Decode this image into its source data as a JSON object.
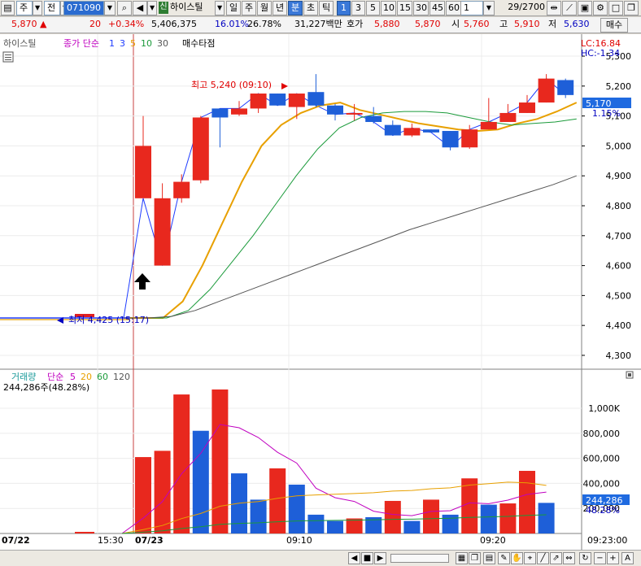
{
  "toolbar": {
    "market_code": "주",
    "prev_label": "전",
    "stock_code": "071090",
    "badge_new": "신",
    "stock_name": "하이스틸",
    "periods": [
      "일",
      "주",
      "월",
      "년",
      "분",
      "초",
      "틱"
    ],
    "selected_period": "분",
    "intervals": [
      "1",
      "3",
      "5",
      "10",
      "15",
      "30",
      "45",
      "60"
    ],
    "selected_interval": "1",
    "count_value": "1",
    "page_counter": "29/2700"
  },
  "quote": {
    "price": "5,870",
    "price_arrow": "▲",
    "change": "20",
    "change_pct": "+0.34%",
    "volume": "5,406,375",
    "vol_ratio1": "16.01%",
    "vol_ratio2": "26.78%",
    "amount": "31,227백만",
    "bid_label": "호가",
    "bid1": "5,880",
    "bid2": "5,870",
    "open_label": "시",
    "open": "5,760",
    "high_label": "고",
    "high": "5,910",
    "low_label": "저",
    "low": "5,630",
    "buy_label": "매수"
  },
  "price_panel": {
    "legend_name": "하이스틸",
    "legend_ma": "종가 단순",
    "ma_periods": [
      "1",
      "3",
      "5",
      "10",
      "30"
    ],
    "ma_colors": [
      "#1e3cff",
      "#1e3cff",
      "#e8a000",
      "#1a9a3a",
      "#555555"
    ],
    "legend_extra": "매수타점",
    "lc_label": "LC:16.84",
    "hc_label": "HC:-1.34",
    "high_annot": "최고 5,240 (09:10)",
    "low_annot": "최저 4,425 (15:17)",
    "current_price": "5,170",
    "current_pct": "1.15%"
  },
  "volume_panel": {
    "legend_name": "거래량",
    "legend_ma": "단순",
    "ma_periods": [
      "5",
      "20",
      "60",
      "120"
    ],
    "ma_colors": [
      "#c000c0",
      "#e8a000",
      "#1a9a3a",
      "#555555"
    ],
    "current_volume": "244,286주(48.28%)",
    "axis_current": "244,286",
    "axis_pct": "48.28%"
  },
  "x_axis": {
    "labels": [
      "07/22",
      "15:30",
      "07/23",
      "09:10",
      "09:20",
      "09:23:00"
    ]
  },
  "chart_data": {
    "type": "candlestick",
    "y_axis_ticks": [
      "5,300",
      "5,200",
      "5,100",
      "5,000",
      "4,900",
      "4,800",
      "4,700",
      "4,600",
      "4,500",
      "4,400",
      "4,300"
    ],
    "y_range": [
      4270,
      5330
    ],
    "volume_axis_ticks": [
      "1,000K",
      "800,000",
      "600,000",
      "400,000",
      "200,000"
    ],
    "volume_range": [
      0,
      1130000
    ],
    "candles": [
      {
        "o": 5000,
        "h": 5100,
        "l": 4995,
        "c": 4825,
        "up": true
      },
      {
        "o": 4825,
        "h": 4875,
        "l": 4710,
        "c": 4600,
        "up": true
      },
      {
        "o": 4825,
        "h": 4905,
        "l": 4810,
        "c": 4880,
        "up": true
      },
      {
        "o": 4885,
        "h": 5100,
        "l": 4875,
        "c": 5095,
        "up": true
      },
      {
        "o": 5095,
        "h": 5115,
        "l": 4995,
        "c": 5125,
        "up": false
      },
      {
        "o": 5105,
        "h": 5150,
        "l": 5100,
        "c": 5125,
        "up": true
      },
      {
        "o": 5125,
        "h": 5170,
        "l": 5110,
        "c": 5175,
        "up": true
      },
      {
        "o": 5175,
        "h": 5175,
        "l": 5135,
        "c": 5135,
        "up": false
      },
      {
        "o": 5130,
        "h": 5175,
        "l": 5090,
        "c": 5175,
        "up": true
      },
      {
        "o": 5180,
        "h": 5240,
        "l": 5130,
        "c": 5135,
        "up": false
      },
      {
        "o": 5135,
        "h": 5140,
        "l": 5085,
        "c": 5105,
        "up": false
      },
      {
        "o": 5105,
        "h": 5140,
        "l": 5085,
        "c": 5110,
        "up": true
      },
      {
        "o": 5100,
        "h": 5130,
        "l": 5075,
        "c": 5080,
        "up": false
      },
      {
        "o": 5070,
        "h": 5085,
        "l": 5035,
        "c": 5035,
        "up": false
      },
      {
        "o": 5035,
        "h": 5075,
        "l": 5030,
        "c": 5060,
        "up": true
      },
      {
        "o": 5055,
        "h": 5055,
        "l": 5045,
        "c": 5045,
        "up": false
      },
      {
        "o": 5050,
        "h": 5050,
        "l": 4985,
        "c": 4995,
        "up": false
      },
      {
        "o": 4995,
        "h": 5070,
        "l": 4990,
        "c": 5055,
        "up": true
      },
      {
        "o": 5055,
        "h": 5160,
        "l": 5055,
        "c": 5080,
        "up": true
      },
      {
        "o": 5080,
        "h": 5140,
        "l": 5080,
        "c": 5110,
        "up": true
      },
      {
        "o": 5110,
        "h": 5170,
        "l": 5110,
        "c": 5145,
        "up": true
      },
      {
        "o": 5145,
        "h": 5240,
        "l": 5145,
        "c": 5225,
        "up": true
      },
      {
        "o": 5220,
        "h": 5225,
        "l": 5160,
        "c": 5170,
        "up": false
      }
    ],
    "volumes": [
      {
        "v": 610000,
        "up": true
      },
      {
        "v": 660000,
        "up": true
      },
      {
        "v": 1110000,
        "up": true
      },
      {
        "v": 820000,
        "up": false
      },
      {
        "v": 1150000,
        "up": true
      },
      {
        "v": 480000,
        "up": false
      },
      {
        "v": 270000,
        "up": false
      },
      {
        "v": 520000,
        "up": true
      },
      {
        "v": 390000,
        "up": false
      },
      {
        "v": 150000,
        "up": false
      },
      {
        "v": 100000,
        "up": false
      },
      {
        "v": 120000,
        "up": true
      },
      {
        "v": 130000,
        "up": false
      },
      {
        "v": 260000,
        "up": true
      },
      {
        "v": 100000,
        "up": false
      },
      {
        "v": 270000,
        "up": true
      },
      {
        "v": 150000,
        "up": false
      },
      {
        "v": 440000,
        "up": true
      },
      {
        "v": 230000,
        "up": false
      },
      {
        "v": 240000,
        "up": true
      },
      {
        "v": 500000,
        "up": true
      },
      {
        "v": 244286,
        "up": false
      }
    ],
    "ma_series": [
      {
        "name": "5",
        "color": "#e8a000",
        "values": [
          4425,
          4425,
          4425,
          4480,
          4600,
          4740,
          4880,
          5000,
          5070,
          5110,
          5135,
          5145,
          5120,
          5105,
          5090,
          5075,
          5065,
          5055,
          5050,
          5055,
          5075,
          5090,
          5115,
          5145
        ]
      },
      {
        "name": "10",
        "color": "#1a9a3a",
        "values": [
          4425,
          4425,
          4425,
          4450,
          4520,
          4610,
          4700,
          4800,
          4900,
          4990,
          5060,
          5095,
          5110,
          5115,
          5115,
          5110,
          5095,
          5080,
          5070,
          5075,
          5080,
          5090
        ]
      },
      {
        "name": "30",
        "color": "#555555",
        "values": [
          4425,
          4425,
          4430,
          4450,
          4480,
          4510,
          4540,
          4570,
          4600,
          4630,
          4660,
          4690,
          4720,
          4745,
          4770,
          4795,
          4820,
          4845,
          4870,
          4900
        ]
      }
    ]
  }
}
